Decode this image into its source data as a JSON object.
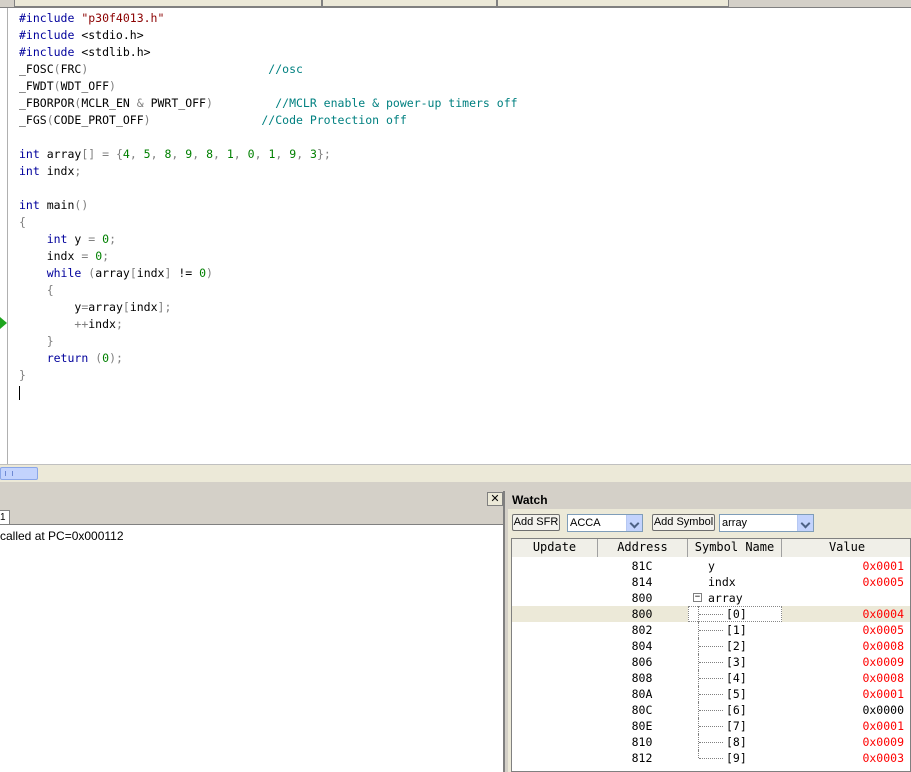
{
  "editor": {
    "lines": [
      [
        {
          "t": "#include ",
          "c": "kw"
        },
        {
          "t": "\"p30f4013.h\"",
          "c": "str"
        }
      ],
      [
        {
          "t": "#include ",
          "c": "kw"
        },
        {
          "t": "<stdio.h>",
          "c": ""
        }
      ],
      [
        {
          "t": "#include ",
          "c": "kw"
        },
        {
          "t": "<stdlib.h>",
          "c": ""
        }
      ],
      [
        {
          "t": "_FOSC",
          "c": ""
        },
        {
          "t": "(",
          "c": "op"
        },
        {
          "t": "FRC",
          "c": ""
        },
        {
          "t": ")",
          "c": "op"
        },
        {
          "t": "                          ",
          "c": ""
        },
        {
          "t": "//osc",
          "c": "cmt"
        }
      ],
      [
        {
          "t": "_FWDT",
          "c": ""
        },
        {
          "t": "(",
          "c": "op"
        },
        {
          "t": "WDT_OFF",
          "c": ""
        },
        {
          "t": ")",
          "c": "op"
        }
      ],
      [
        {
          "t": "_FBORPOR",
          "c": ""
        },
        {
          "t": "(",
          "c": "op"
        },
        {
          "t": "MCLR_EN ",
          "c": ""
        },
        {
          "t": "&",
          "c": "op"
        },
        {
          "t": " PWRT_OFF",
          "c": ""
        },
        {
          "t": ")",
          "c": "op"
        },
        {
          "t": "         ",
          "c": ""
        },
        {
          "t": "//MCLR enable & power-up timers off",
          "c": "cmt"
        }
      ],
      [
        {
          "t": "_FGS",
          "c": ""
        },
        {
          "t": "(",
          "c": "op"
        },
        {
          "t": "CODE_PROT_OFF",
          "c": ""
        },
        {
          "t": ")",
          "c": "op"
        },
        {
          "t": "                ",
          "c": ""
        },
        {
          "t": "//Code Protection off",
          "c": "cmt"
        }
      ],
      [
        {
          "t": "",
          "c": ""
        }
      ],
      [
        {
          "t": "int",
          "c": "kw"
        },
        {
          "t": " array",
          "c": ""
        },
        {
          "t": "[] = {",
          "c": "op"
        },
        {
          "t": "4",
          "c": "num"
        },
        {
          "t": ", ",
          "c": "op"
        },
        {
          "t": "5",
          "c": "num"
        },
        {
          "t": ", ",
          "c": "op"
        },
        {
          "t": "8",
          "c": "num"
        },
        {
          "t": ", ",
          "c": "op"
        },
        {
          "t": "9",
          "c": "num"
        },
        {
          "t": ", ",
          "c": "op"
        },
        {
          "t": "8",
          "c": "num"
        },
        {
          "t": ", ",
          "c": "op"
        },
        {
          "t": "1",
          "c": "num"
        },
        {
          "t": ", ",
          "c": "op"
        },
        {
          "t": "0",
          "c": "num"
        },
        {
          "t": ", ",
          "c": "op"
        },
        {
          "t": "1",
          "c": "num"
        },
        {
          "t": ", ",
          "c": "op"
        },
        {
          "t": "9",
          "c": "num"
        },
        {
          "t": ", ",
          "c": "op"
        },
        {
          "t": "3",
          "c": "num"
        },
        {
          "t": "};",
          "c": "op"
        }
      ],
      [
        {
          "t": "int",
          "c": "kw"
        },
        {
          "t": " indx",
          "c": ""
        },
        {
          "t": ";",
          "c": "op"
        }
      ],
      [
        {
          "t": "",
          "c": ""
        }
      ],
      [
        {
          "t": "int",
          "c": "kw"
        },
        {
          "t": " main",
          "c": ""
        },
        {
          "t": "()",
          "c": "op"
        }
      ],
      [
        {
          "t": "{",
          "c": "op"
        }
      ],
      [
        {
          "t": "    ",
          "c": ""
        },
        {
          "t": "int",
          "c": "kw"
        },
        {
          "t": " y ",
          "c": ""
        },
        {
          "t": "=",
          "c": "op"
        },
        {
          "t": " ",
          "c": ""
        },
        {
          "t": "0",
          "c": "num"
        },
        {
          "t": ";",
          "c": "op"
        }
      ],
      [
        {
          "t": "    indx ",
          "c": ""
        },
        {
          "t": "=",
          "c": "op"
        },
        {
          "t": " ",
          "c": ""
        },
        {
          "t": "0",
          "c": "num"
        },
        {
          "t": ";",
          "c": "op"
        }
      ],
      [
        {
          "t": "    ",
          "c": ""
        },
        {
          "t": "while",
          "c": "kw"
        },
        {
          "t": " ",
          "c": ""
        },
        {
          "t": "(",
          "c": "op"
        },
        {
          "t": "array",
          "c": ""
        },
        {
          "t": "[",
          "c": "op"
        },
        {
          "t": "indx",
          "c": ""
        },
        {
          "t": "]",
          "c": "op"
        },
        {
          "t": " != ",
          "c": ""
        },
        {
          "t": "0",
          "c": "num"
        },
        {
          "t": ")",
          "c": "op"
        }
      ],
      [
        {
          "t": "    ",
          "c": ""
        },
        {
          "t": "{",
          "c": "op"
        }
      ],
      [
        {
          "t": "        y",
          "c": ""
        },
        {
          "t": "=",
          "c": "op"
        },
        {
          "t": "array",
          "c": ""
        },
        {
          "t": "[",
          "c": "op"
        },
        {
          "t": "indx",
          "c": ""
        },
        {
          "t": "];",
          "c": "op"
        }
      ],
      [
        {
          "t": "        ",
          "c": ""
        },
        {
          "t": "++",
          "c": "op"
        },
        {
          "t": "indx",
          "c": ""
        },
        {
          "t": ";",
          "c": "op"
        }
      ],
      [
        {
          "t": "    ",
          "c": ""
        },
        {
          "t": "}",
          "c": "op"
        }
      ],
      [
        {
          "t": "    ",
          "c": ""
        },
        {
          "t": "return",
          "c": "kw"
        },
        {
          "t": " ",
          "c": ""
        },
        {
          "t": "(",
          "c": "op"
        },
        {
          "t": "0",
          "c": "num"
        },
        {
          "t": ");",
          "c": "op"
        }
      ],
      [
        {
          "t": "}",
          "c": "op"
        }
      ],
      [
        {
          "t": "",
          "c": "caret"
        }
      ]
    ]
  },
  "output": {
    "close_label": "✕",
    "tab_label": "1",
    "message": "called at PC=0x000112"
  },
  "watch": {
    "title": "Watch",
    "add_sfr_label": "Add SFR",
    "sfr_selected": "ACCA",
    "add_symbol_label": "Add Symbol",
    "symbol_selected": "array",
    "columns": [
      "Update",
      "Address",
      "Symbol Name",
      "Value"
    ],
    "rows": [
      {
        "address": "81C",
        "symbol": "y",
        "value": "0x0001",
        "changed": true,
        "level": 0
      },
      {
        "address": "814",
        "symbol": "indx",
        "value": "0x0005",
        "changed": true,
        "level": 0
      },
      {
        "address": "800",
        "symbol": "array",
        "value": "",
        "changed": false,
        "level": 0,
        "expanded": true
      },
      {
        "address": "800",
        "symbol": "[0]",
        "value": "0x0004",
        "changed": true,
        "level": 1,
        "selected": true
      },
      {
        "address": "802",
        "symbol": "[1]",
        "value": "0x0005",
        "changed": true,
        "level": 1
      },
      {
        "address": "804",
        "symbol": "[2]",
        "value": "0x0008",
        "changed": true,
        "level": 1
      },
      {
        "address": "806",
        "symbol": "[3]",
        "value": "0x0009",
        "changed": true,
        "level": 1
      },
      {
        "address": "808",
        "symbol": "[4]",
        "value": "0x0008",
        "changed": true,
        "level": 1
      },
      {
        "address": "80A",
        "symbol": "[5]",
        "value": "0x0001",
        "changed": true,
        "level": 1
      },
      {
        "address": "80C",
        "symbol": "[6]",
        "value": "0x0000",
        "changed": false,
        "level": 1
      },
      {
        "address": "80E",
        "symbol": "[7]",
        "value": "0x0001",
        "changed": true,
        "level": 1
      },
      {
        "address": "810",
        "symbol": "[8]",
        "value": "0x0009",
        "changed": true,
        "level": 1
      },
      {
        "address": "812",
        "symbol": "[9]",
        "value": "0x0003",
        "changed": true,
        "level": 1
      }
    ]
  }
}
